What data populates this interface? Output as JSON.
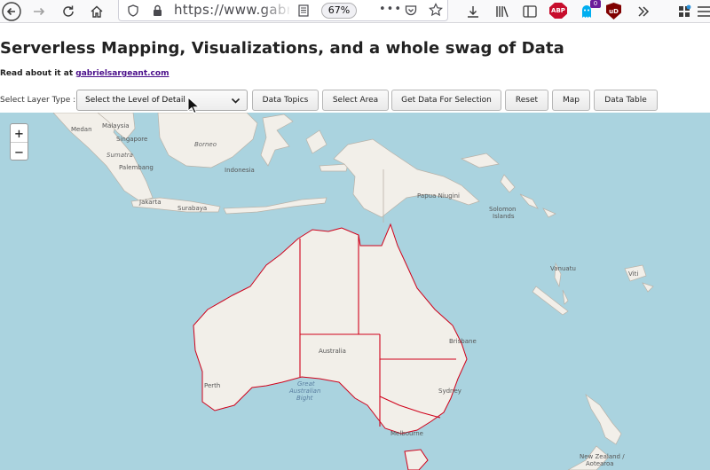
{
  "browser": {
    "url": "https://www.gabri",
    "zoom": "67%",
    "abp_label": "ABP",
    "ub_label": "uD",
    "badge_count": "0"
  },
  "page": {
    "title": "Serverless Mapping, Visualizations, and a whole swag of Data",
    "read_prefix": "Read about it at ",
    "read_link": "gabrielsargeant.com"
  },
  "controls": {
    "layer_label": "Select Layer Type :",
    "select_value": "Select the Level of Detail",
    "buttons": {
      "data_topics": "Data Topics",
      "select_area": "Select Area",
      "get_data": "Get Data For Selection",
      "reset": "Reset",
      "map": "Map",
      "data_table": "Data Table"
    }
  },
  "map": {
    "zoom_in": "+",
    "zoom_out": "−",
    "labels": {
      "medan": "Medan",
      "malaysia": "Malaysia",
      "singapore": "Singapore",
      "borneo": "Borneo",
      "sumatra": "Sumatra",
      "palembang": "Palembang",
      "indonesia": "Indonesia",
      "jakarta": "Jakarta",
      "surabaya": "Surabaya",
      "papua": "Papua Niugini",
      "solomon1": "Solomon",
      "solomon2": "Islands",
      "vanuatu": "Vanuatu",
      "viti": "Viti",
      "australia": "Australia",
      "brisbane": "Brisbane",
      "perth": "Perth",
      "bight1": "Great",
      "bight2": "Australian",
      "bight3": "Bight",
      "sydney": "Sydney",
      "melbourne": "Melbourne",
      "nz1": "New Zealand /",
      "nz2": "Aotearoa"
    },
    "colors": {
      "water": "#aad3df",
      "land": "#f2efe9",
      "boundary": "#d0021b"
    }
  }
}
